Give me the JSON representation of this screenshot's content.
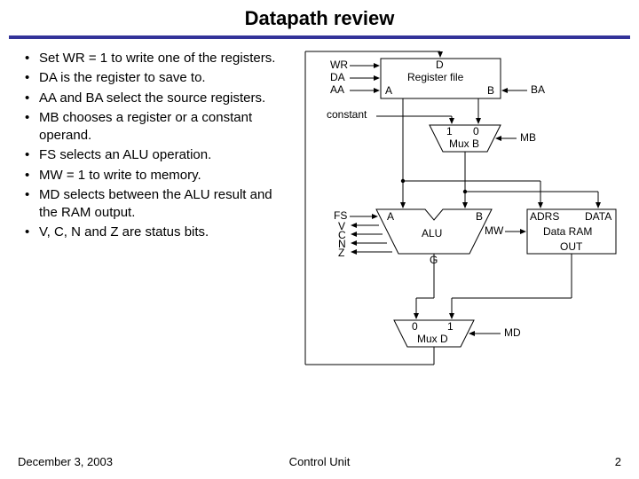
{
  "title": "Datapath review",
  "bullets": [
    "Set WR = 1 to write one of the registers.",
    "DA is the register to save to.",
    "AA and BA select the source registers.",
    "MB chooses a register or a constant operand.",
    "FS selects an ALU operation.",
    "MW = 1 to write to memory.",
    "MD selects between the ALU result and the RAM output.",
    "V, C, N and Z are status bits."
  ],
  "labels": {
    "WR": "WR",
    "DA": "DA",
    "AA": "AA",
    "BA": "BA",
    "constant": "constant",
    "one": "1",
    "zero": "0",
    "MuxB": "Mux B",
    "MB": "MB",
    "FS": "FS",
    "V": "V",
    "C": "C",
    "N": "N",
    "Z": "Z",
    "A_top": "A",
    "B_top": "B",
    "A_alu": "A",
    "B_alu": "B",
    "ALU": "ALU",
    "G": "G",
    "ADRS": "ADRS",
    "DATA": "DATA",
    "DataRAM": "Data RAM",
    "OUT": "OUT",
    "MW": "MW",
    "zero2": "0",
    "one2": "1",
    "MuxD": "Mux D",
    "MD": "MD",
    "D": "D",
    "RegFile": "Register file"
  },
  "footer": {
    "date": "December 3, 2003",
    "center": "Control Unit",
    "page": "2"
  }
}
